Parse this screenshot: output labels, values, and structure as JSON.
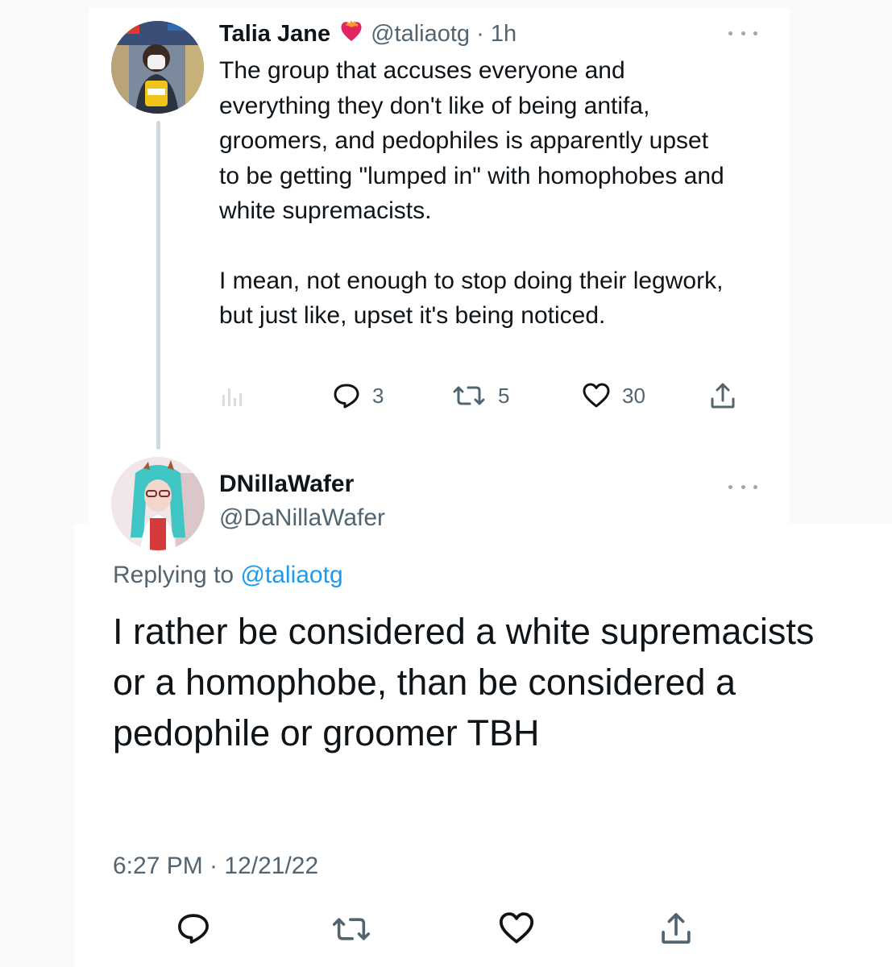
{
  "tweet1": {
    "author_name": "Talia Jane",
    "handle_time": "@taliaotg · 1h",
    "paragraphs": [
      "The group that accuses everyone and everything they don't like of being antifa, groomers, and pedophiles is apparently upset to be getting \"lumped in\" with homophobes and white supremacists.",
      "I mean, not enough to stop doing their legwork, but just like, upset it's being noticed."
    ],
    "stats": {
      "replies": "3",
      "retweets": "5",
      "likes": "30"
    },
    "badge_icon": "heart-fire-icon"
  },
  "tweet2": {
    "author_name": "DNillaWafer",
    "handle": "@DaNillaWafer",
    "replying_prefix": "Replying to ",
    "replying_handle": "@taliaotg",
    "text": "I rather be considered a white supremacists or a homophobe, than be considered a pedophile or groomer TBH",
    "timestamp": "6:27 PM · 12/21/22"
  },
  "icons": {
    "analytics": "analytics-icon",
    "reply": "reply-icon",
    "retweet": "retweet-icon",
    "like": "heart-icon",
    "share": "share-icon",
    "more": "more-icon"
  },
  "colors": {
    "text": "#0f1419",
    "muted": "#536471",
    "link": "#1d9bf0",
    "thread_line": "#cfd9de",
    "badge": "#e0245e"
  }
}
